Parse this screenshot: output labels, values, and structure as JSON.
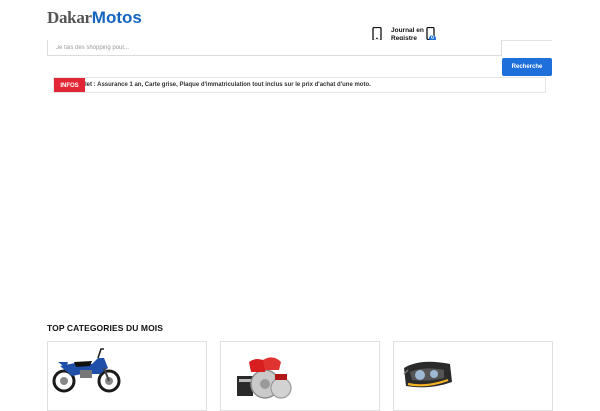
{
  "header": {
    "logo": {
      "part1": "Dakar",
      "part2": "Motos",
      "color": "#1565c0"
    },
    "account": {
      "line1": "Journal en",
      "line2": "Registre",
      "icon": "mobile-phone-icon"
    },
    "cart": {
      "count": "0",
      "icon": "cart-phone-icon"
    }
  },
  "search": {
    "placeholder": "Je fais des shopping pour...",
    "button_label": "Recherche",
    "accent": "#1e6fd9"
  },
  "info": {
    "badge": "INFOS",
    "text": "let : Assurance 1 an, Carte grise, Plaque d'immatriculation tout inclus sur le prix d'achat d'une moto.",
    "badge_color": "#e32636"
  },
  "categories": {
    "title": "TOP CATEGORIES DU MOIS",
    "items": [
      {
        "image": "motorcycle-image"
      },
      {
        "image": "brake-kit-image"
      },
      {
        "image": "headlight-image"
      }
    ]
  }
}
